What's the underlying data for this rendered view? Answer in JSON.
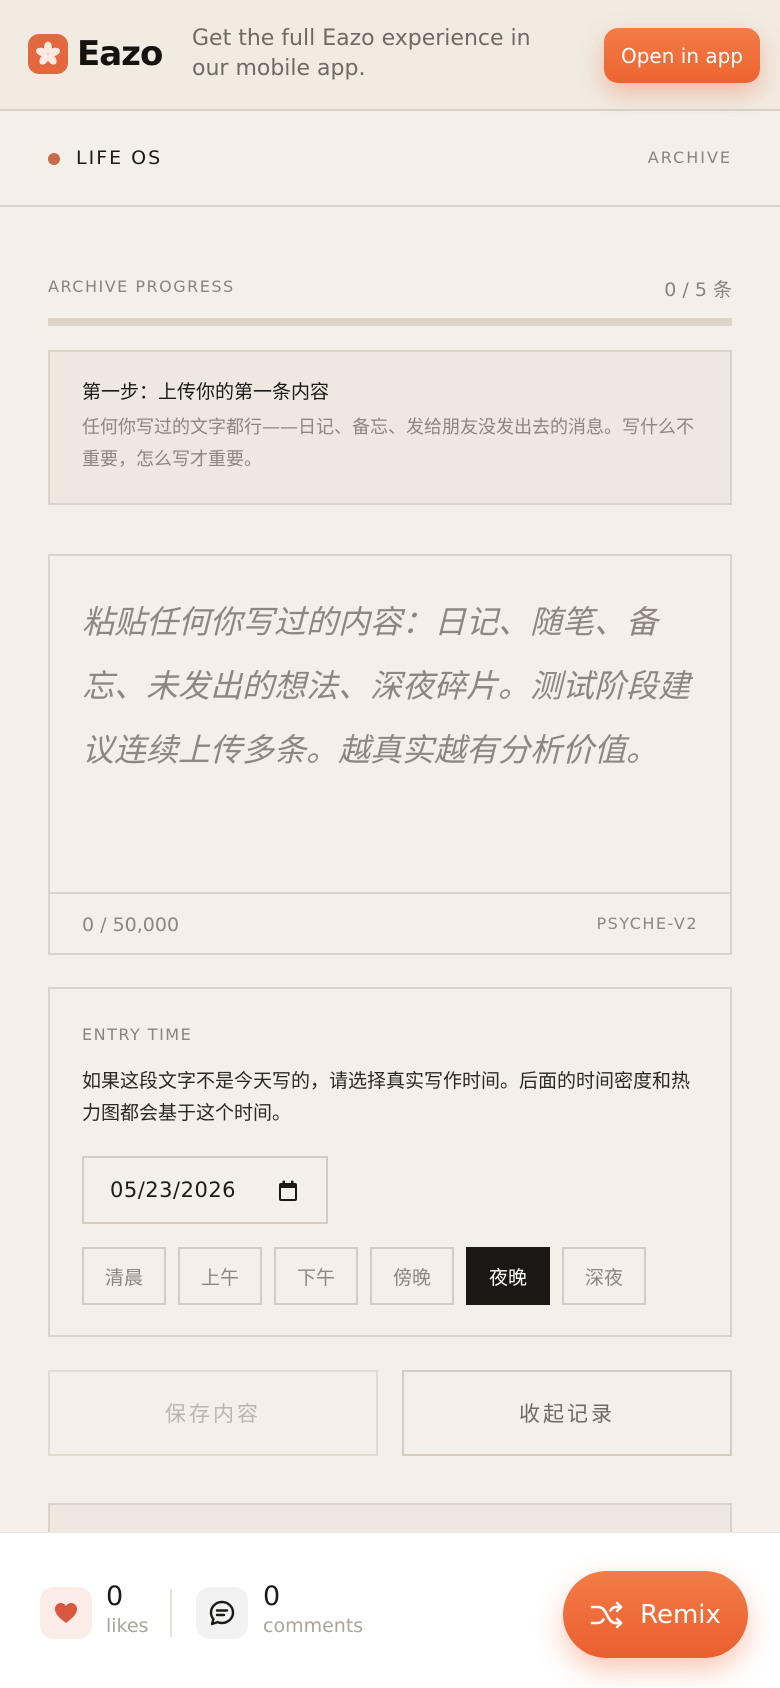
{
  "promo": {
    "brand": "Eazo",
    "message": "Get the full Eazo experience in our mobile app.",
    "open_label": "Open in app"
  },
  "header": {
    "brand": "LIFE OS",
    "archive": "ARCHIVE"
  },
  "progress": {
    "label": "ARCHIVE PROGRESS",
    "count_text": "0 / 5 条",
    "current": 0,
    "total": 5
  },
  "step": {
    "title": "第一步：上传你的第一条内容",
    "desc": "任何你写过的文字都行——日记、备忘、发给朋友没发出去的消息。写什么不重要，怎么写才重要。"
  },
  "editor": {
    "placeholder": "粘贴任何你写过的内容：日记、随笔、备忘、未发出的想法、深夜碎片。测试阶段建议连续上传多条。越真实越有分析价值。",
    "char_count": "0 / 50,000",
    "model": "PSYCHE-V2"
  },
  "entry": {
    "label": "ENTRY TIME",
    "desc": "如果这段文字不是今天写的，请选择真实写作时间。后面的时间密度和热力图都会基于这个时间。",
    "date": "05/23/2026",
    "slots": [
      "清晨",
      "上午",
      "下午",
      "傍晚",
      "夜晚",
      "深夜"
    ],
    "active_slot": "夜晚"
  },
  "actions": {
    "save": "保存内容",
    "collapse": "收起记录"
  },
  "social": {
    "likes": "0",
    "likes_label": "likes",
    "comments": "0",
    "comments_label": "comments",
    "remix": "Remix"
  },
  "colors": {
    "accent": "#ec6431",
    "dot": "#c8694b",
    "background": "#f4efe8",
    "active_slot": "#1a1816"
  }
}
